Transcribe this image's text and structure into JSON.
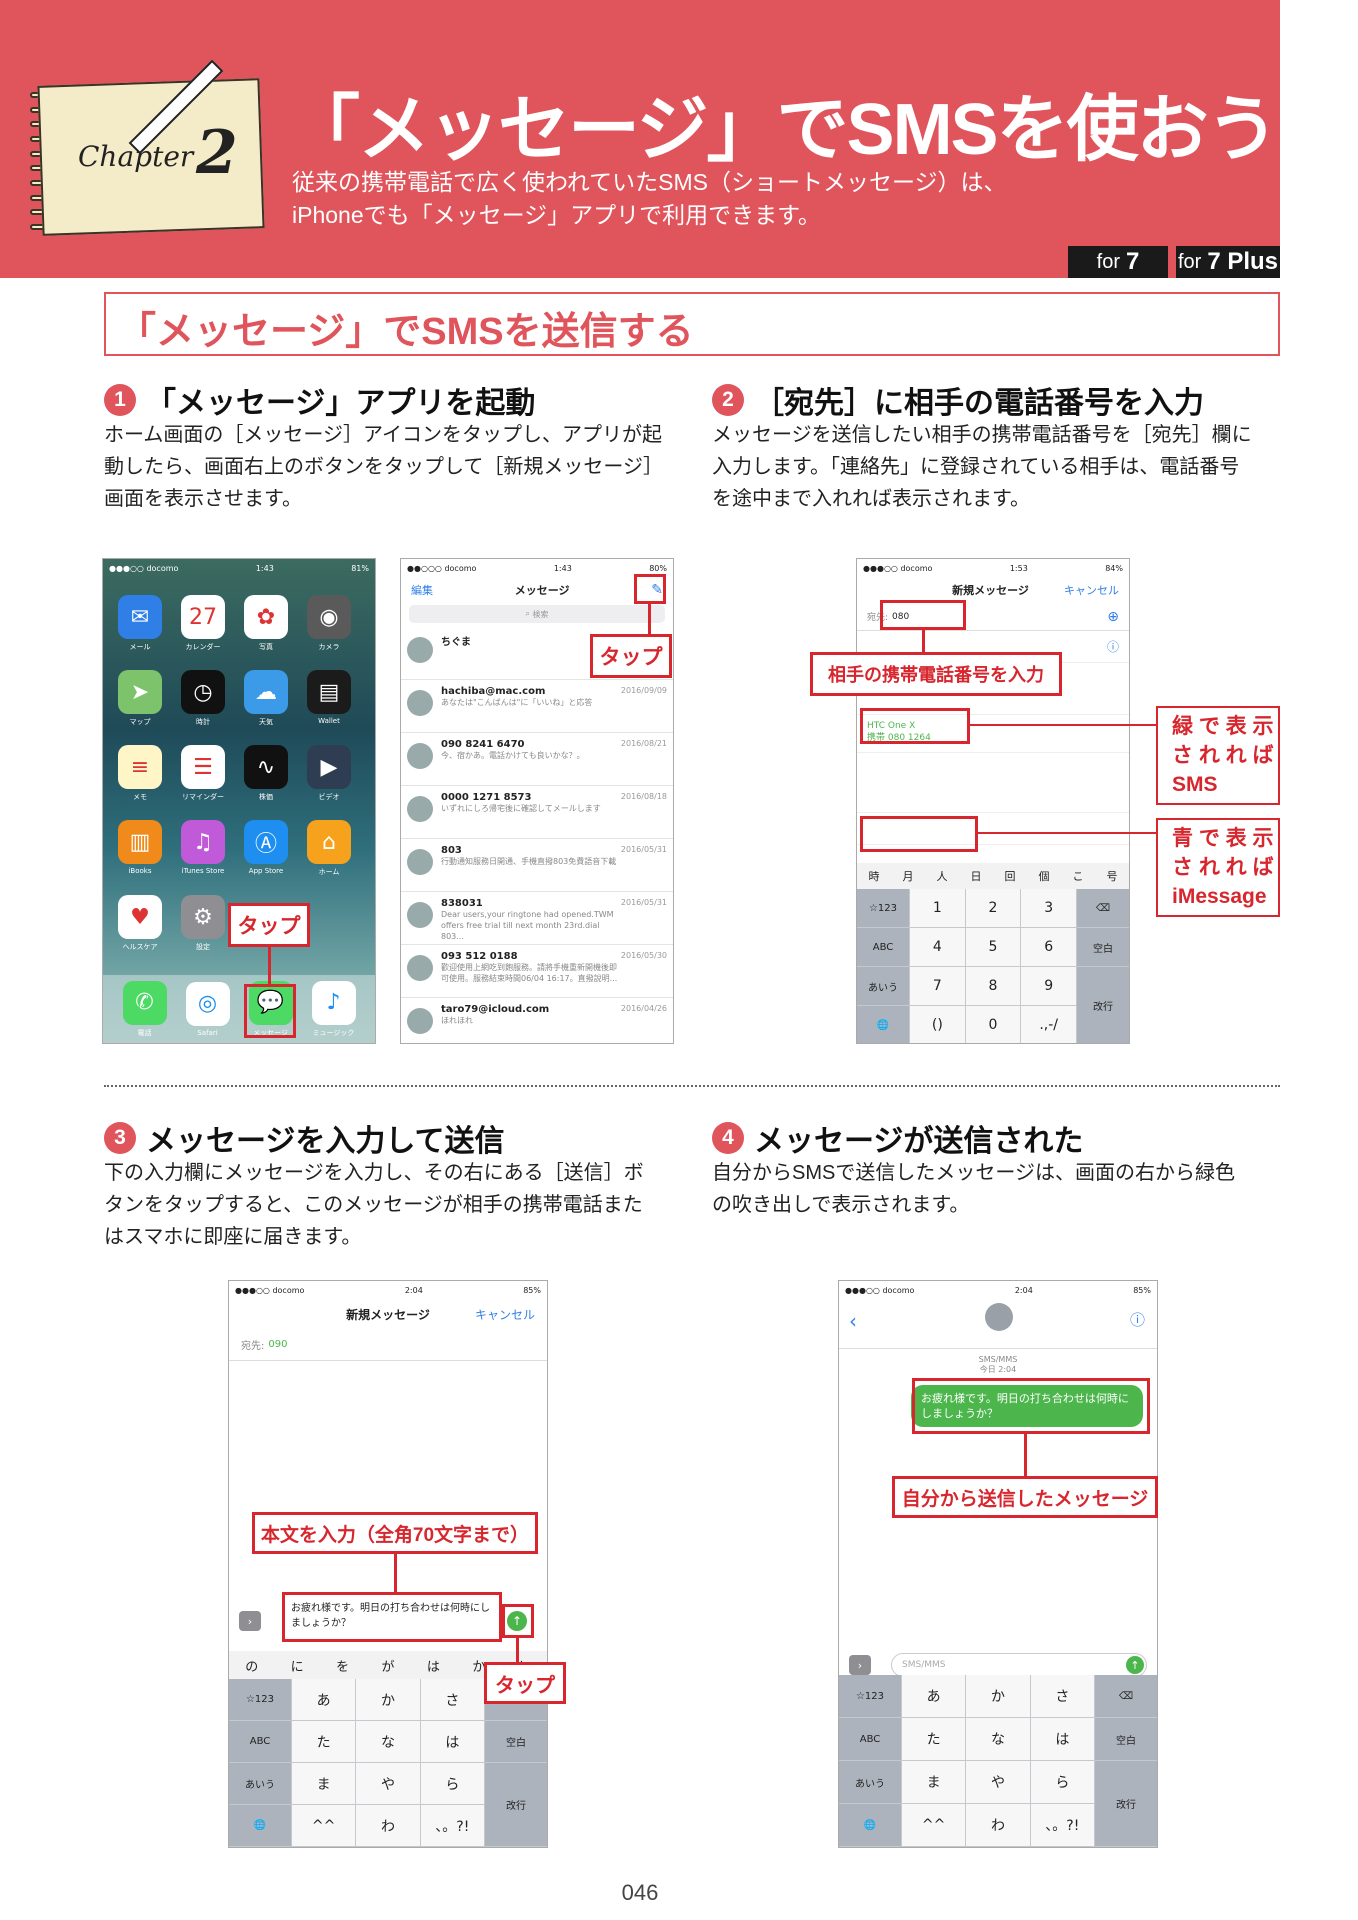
{
  "header": {
    "chapter_word": "Chapter",
    "chapter_num": "2",
    "title": "「メッセージ」でSMSを使おう",
    "subtitle_1": "従来の携帯電話で広く使われていたSMS（ショートメッセージ）は、",
    "subtitle_2": "iPhoneでも「メッセージ」アプリで利用できます。",
    "badge_1_pre": "for",
    "badge_1_model": "7",
    "badge_2_pre": "for",
    "badge_2_model": "7 Plus"
  },
  "section_title": "「メッセージ」でSMSを送信する",
  "steps": [
    {
      "num": "1",
      "title": "「メッセージ」アプリを起動",
      "lines": [
        "ホーム画面の［メッセージ］アイコンをタップし、アプリが起",
        "動したら、画面右上のボタンをタップして［新規メッセージ］",
        "画面を表示させます。"
      ]
    },
    {
      "num": "2",
      "title": "［宛先］に相手の電話番号を入力",
      "lines": [
        "メッセージを送信したい相手の携帯電話番号を［宛先］欄に",
        "入力します。「連絡先」に登録されている相手は、電話番号",
        "を途中まで入れれば表示されます。"
      ]
    },
    {
      "num": "3",
      "title": "メッセージを入力して送信",
      "lines": [
        "下の入力欄にメッセージを入力し、その右にある［送信］ボ",
        "タンをタップすると、このメッセージが相手の携帯電話また",
        "はスマホに即座に届きます。"
      ]
    },
    {
      "num": "4",
      "title": "メッセージが送信された",
      "lines": [
        "自分からSMSで送信したメッセージは、画面の右から緑色",
        "の吹き出しで表示されます。"
      ]
    }
  ],
  "callouts": {
    "tap": "タップ",
    "enter_number": "相手の携帯電話番号を入力",
    "green_note": [
      "緑 で 表 示",
      "さ れ れ ば",
      "SMS"
    ],
    "blue_note": [
      "青 で 表 示",
      "さ れ れ ば",
      "iMessage"
    ],
    "body_input": "本文を入力（全角70文字まで）",
    "sent_msg": "自分から送信したメッセージ"
  },
  "screens": {
    "home": {
      "carrier": "●●●○○ docomo",
      "time": "1:43",
      "battery": "81%",
      "apps": [
        {
          "label": "メール",
          "icon": "mail-icon",
          "color": "#2f7fe6",
          "glyph": "✉"
        },
        {
          "label": "カレンダー",
          "icon": "calendar-icon",
          "color": "#ffffff",
          "glyph": "27"
        },
        {
          "label": "写真",
          "icon": "photos-icon",
          "color": "#ffffff",
          "glyph": "✿"
        },
        {
          "label": "カメラ",
          "icon": "camera-icon",
          "color": "#5a5a5a",
          "glyph": "◉"
        },
        {
          "label": "マップ",
          "icon": "maps-icon",
          "color": "#7cc36b",
          "glyph": "➤"
        },
        {
          "label": "時計",
          "icon": "clock-icon",
          "color": "#111111",
          "glyph": "◷"
        },
        {
          "label": "天気",
          "icon": "weather-icon",
          "color": "#3c9be8",
          "glyph": "☁"
        },
        {
          "label": "Wallet",
          "icon": "wallet-icon",
          "color": "#1b1b1b",
          "glyph": "▤"
        },
        {
          "label": "メモ",
          "icon": "notes-icon",
          "color": "#fff6c8",
          "glyph": "≡"
        },
        {
          "label": "リマインダー",
          "icon": "reminders-icon",
          "color": "#ffffff",
          "glyph": "☰"
        },
        {
          "label": "株価",
          "icon": "stocks-icon",
          "color": "#111111",
          "glyph": "∿"
        },
        {
          "label": "ビデオ",
          "icon": "videos-icon",
          "color": "#2e3d52",
          "glyph": "▶"
        },
        {
          "label": "iBooks",
          "icon": "ibooks-icon",
          "color": "#f08b1b",
          "glyph": "▥"
        },
        {
          "label": "iTunes Store",
          "icon": "itunes-icon",
          "color": "#c05ad8",
          "glyph": "♫"
        },
        {
          "label": "App Store",
          "icon": "appstore-icon",
          "color": "#1e8ef0",
          "glyph": "Ⓐ"
        },
        {
          "label": "ホーム",
          "icon": "home-app-icon",
          "color": "#f6a21d",
          "glyph": "⌂"
        },
        {
          "label": "ヘルスケア",
          "icon": "health-icon",
          "color": "#ffffff",
          "glyph": "♥"
        },
        {
          "label": "設定",
          "icon": "settings-icon",
          "color": "#8e8e93",
          "glyph": "⚙"
        }
      ],
      "dock": [
        {
          "label": "電話",
          "icon": "phone-icon",
          "color": "#4cd964",
          "glyph": "✆"
        },
        {
          "label": "Safari",
          "icon": "safari-icon",
          "color": "#ffffff",
          "glyph": "◎"
        },
        {
          "label": "メッセージ",
          "icon": "messages-icon",
          "color": "#4cd964",
          "glyph": "💬"
        },
        {
          "label": "ミュージック",
          "icon": "music-icon",
          "color": "#ffffff",
          "glyph": "♪"
        }
      ]
    },
    "list": {
      "carrier": "●●○○○ docomo",
      "time": "1:43",
      "battery": "80%",
      "edit": "編集",
      "title": "メッセージ",
      "search": "検索",
      "rows": [
        {
          "name": "ちぐま",
          "preview": "",
          "date": ""
        },
        {
          "name": "hachiba@mac.com",
          "preview": "あなたは\"こんばんは\"に「いいね」と応答",
          "date": "2016/09/09"
        },
        {
          "name": "090 8241 6470",
          "preview": "今、宿かあ。電話かけても良いかな？。",
          "date": "2016/08/21"
        },
        {
          "name": "0000 1271 8573",
          "preview": "いずれにしろ帰宅後に確認してメールします",
          "date": "2016/08/18"
        },
        {
          "name": "803",
          "preview": "行動通知服務日開通、手機直撥803免費語音下載",
          "date": "2016/05/31"
        },
        {
          "name": "838031",
          "preview": "Dear users,your ringtone had opened.TWM offers free trial till next month 23rd.dial 803...",
          "date": "2016/05/31"
        },
        {
          "name": "093 512 0188",
          "preview": "歡迎使用上網吃到飽服務。請將手機重新開機後即可使用。服務結束時間06/04 16:17。直撥說明...",
          "date": "2016/05/30"
        },
        {
          "name": "taro79@icloud.com",
          "preview": "ほれほれ",
          "date": "2016/04/26"
        }
      ]
    },
    "new_msg": {
      "carrier": "●●●○○ docomo",
      "time": "1:53",
      "battery": "84%",
      "title": "新規メッセージ",
      "cancel": "キャンセル",
      "to_label": "宛先:",
      "to_value": "080",
      "htc_name": "HTC One X",
      "htc_num": "携帯  080 1264",
      "kana_row": [
        "時",
        "月",
        "人",
        "日",
        "回",
        "個",
        "こ",
        "号"
      ],
      "keys": [
        [
          "☆123",
          "1",
          "2",
          "3",
          "⌫"
        ],
        [
          "ABC",
          "4",
          "5",
          "6",
          "空白"
        ],
        [
          "あいう",
          "7",
          "8",
          "9",
          "改行"
        ],
        [
          "🌐",
          "()",
          "0",
          ".,-/",
          ""
        ]
      ]
    },
    "compose": {
      "carrier": "●●●○○ docomo",
      "time": "2:04",
      "battery": "85%",
      "title": "新規メッセージ",
      "cancel": "キャンセル",
      "to_label": "宛先:",
      "to_value": "090",
      "body": "お疲れ様です。明日の打ち合わせは何時にしましょうか？",
      "suggest": [
        "の",
        "に",
        "を",
        "が",
        "は",
        "か",
        "と"
      ],
      "keys": [
        [
          "☆123",
          "あ",
          "か",
          "さ",
          "⌫"
        ],
        [
          "ABC",
          "た",
          "な",
          "は",
          "空白"
        ],
        [
          "あいう",
          "ま",
          "や",
          "ら",
          "改行"
        ],
        [
          "🌐",
          "^^",
          "わ",
          "、。?!",
          ""
        ]
      ]
    },
    "sent": {
      "carrier": "●●●○○ docomo",
      "time": "2:04",
      "battery": "85%",
      "meta_1": "SMS/MMS",
      "meta_2": "今日 2:04",
      "bubble": "お疲れ様です。明日の打ち合わせは何時にしましょうか？",
      "placeholder": "SMS/MMS",
      "keys": [
        [
          "☆123",
          "あ",
          "か",
          "さ",
          "⌫"
        ],
        [
          "ABC",
          "た",
          "な",
          "は",
          "空白"
        ],
        [
          "あいう",
          "ま",
          "や",
          "ら",
          "改行"
        ],
        [
          "🌐",
          "^^",
          "わ",
          "、。?!",
          ""
        ]
      ]
    }
  },
  "page_number": "046",
  "colors": {
    "accent": "#e0545c",
    "callout": "#d7262e",
    "imessage_blue": "#2f7fe6",
    "sms_green": "#4cb64c"
  }
}
